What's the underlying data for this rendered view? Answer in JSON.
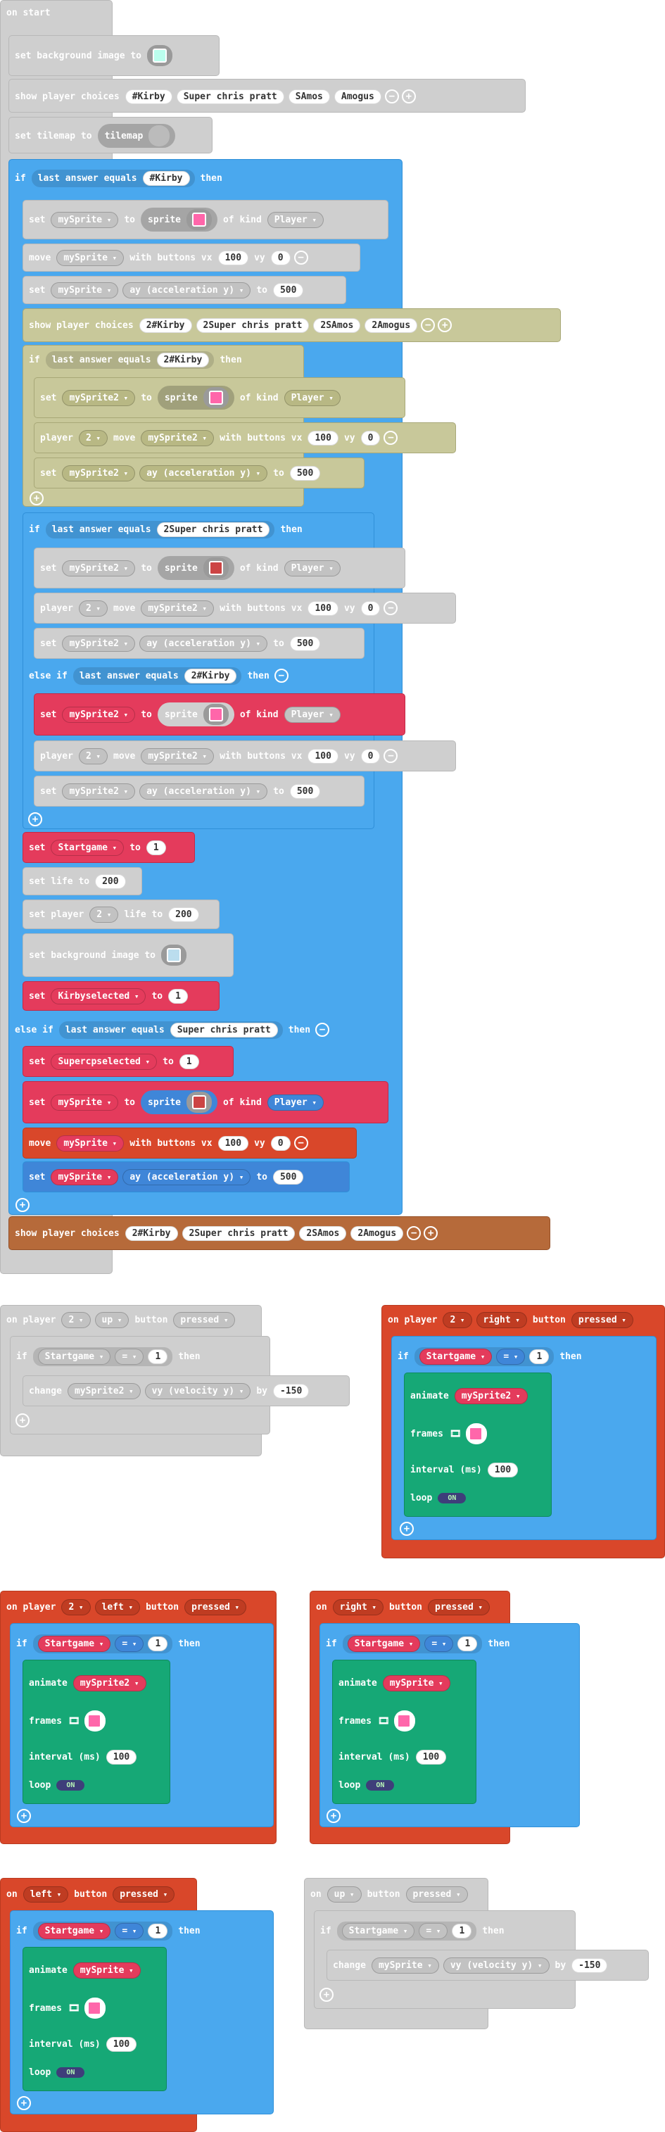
{
  "on_start": {
    "header": "on start",
    "set_bg": "set background image to",
    "show_choices": "show player choices",
    "choices1": [
      "#Kirby",
      "Super chris pratt",
      "SAmos",
      "Amogus"
    ],
    "set_tilemap": "set tilemap to",
    "tilemap": "tilemap",
    "if": "if",
    "last_answer": "last answer equals",
    "then": "then",
    "kirby": "#Kirby",
    "set": "set",
    "mySprite": "mySprite",
    "to": "to",
    "sprite": "sprite",
    "of_kind": "of kind",
    "player": "Player",
    "move": "move",
    "with_buttons_vx": "with buttons vx",
    "vx": "100",
    "vy_lbl": "vy",
    "vy": "0",
    "ay": "ay (acceleration y)",
    "ay_val": "500",
    "choices2": [
      "2#Kirby",
      "2Super chris pratt",
      "2SAmos",
      "2Amogus"
    ],
    "kirby2": "2#Kirby",
    "mySprite2": "mySprite2",
    "player_lbl": "player",
    "p2": "2",
    "schris2": "2Super chris pratt",
    "else_if": "else if",
    "startgame": "Startgame",
    "one": "1",
    "set_life": "set life to",
    "life": "200",
    "set_player": "set player",
    "life_to": "life to",
    "kirbysel": "Kirbyselected",
    "schris": "Super chris pratt",
    "supersel": "Supercpselected"
  },
  "ev_up_p2": {
    "on_player": "on player",
    "p": "2",
    "btn": "up",
    "button": "button",
    "pressed": "pressed",
    "if": "if",
    "sg": "Startgame",
    "eq": "=",
    "v": "1",
    "then": "then",
    "change": "change",
    "spr": "mySprite2",
    "vel": "vy (velocity y)",
    "by": "by",
    "val": "-150"
  },
  "ev_right_p2": {
    "on_player": "on player",
    "p": "2",
    "btn": "right",
    "button": "button",
    "pressed": "pressed",
    "if": "if",
    "sg": "Startgame",
    "eq": "=",
    "v": "1",
    "then": "then",
    "animate": "animate",
    "spr": "mySprite2",
    "frames": "frames",
    "interval": "interval (ms)",
    "ms": "100",
    "loop": "loop",
    "on": "ON"
  },
  "ev_left_p2": {
    "on_player": "on player",
    "p": "2",
    "btn": "left",
    "button": "button",
    "pressed": "pressed",
    "if": "if",
    "sg": "Startgame",
    "eq": "=",
    "v": "1",
    "then": "then",
    "animate": "animate",
    "spr": "mySprite2",
    "frames": "frames",
    "interval": "interval (ms)",
    "ms": "100",
    "loop": "loop",
    "on": "ON"
  },
  "ev_right": {
    "on": "on",
    "btn": "right",
    "button": "button",
    "pressed": "pressed",
    "if": "if",
    "sg": "Startgame",
    "eq": "=",
    "v": "1",
    "then": "then",
    "animate": "animate",
    "spr": "mySprite",
    "frames": "frames",
    "interval": "interval (ms)",
    "ms": "100",
    "loop": "loop",
    "on_t": "ON"
  },
  "ev_left": {
    "on": "on",
    "btn": "left",
    "button": "button",
    "pressed": "pressed",
    "if": "if",
    "sg": "Startgame",
    "eq": "=",
    "v": "1",
    "then": "then",
    "animate": "animate",
    "spr": "mySprite",
    "frames": "frames",
    "interval": "interval (ms)",
    "ms": "100",
    "loop": "loop",
    "on_t": "ON"
  },
  "ev_up": {
    "on": "on",
    "btn": "up",
    "button": "button",
    "pressed": "pressed",
    "if": "if",
    "sg": "Startgame",
    "eq": "=",
    "v": "1",
    "then": "then",
    "change": "change",
    "spr": "mySprite",
    "vel": "vy (velocity y)",
    "by": "by",
    "val": "-150"
  }
}
